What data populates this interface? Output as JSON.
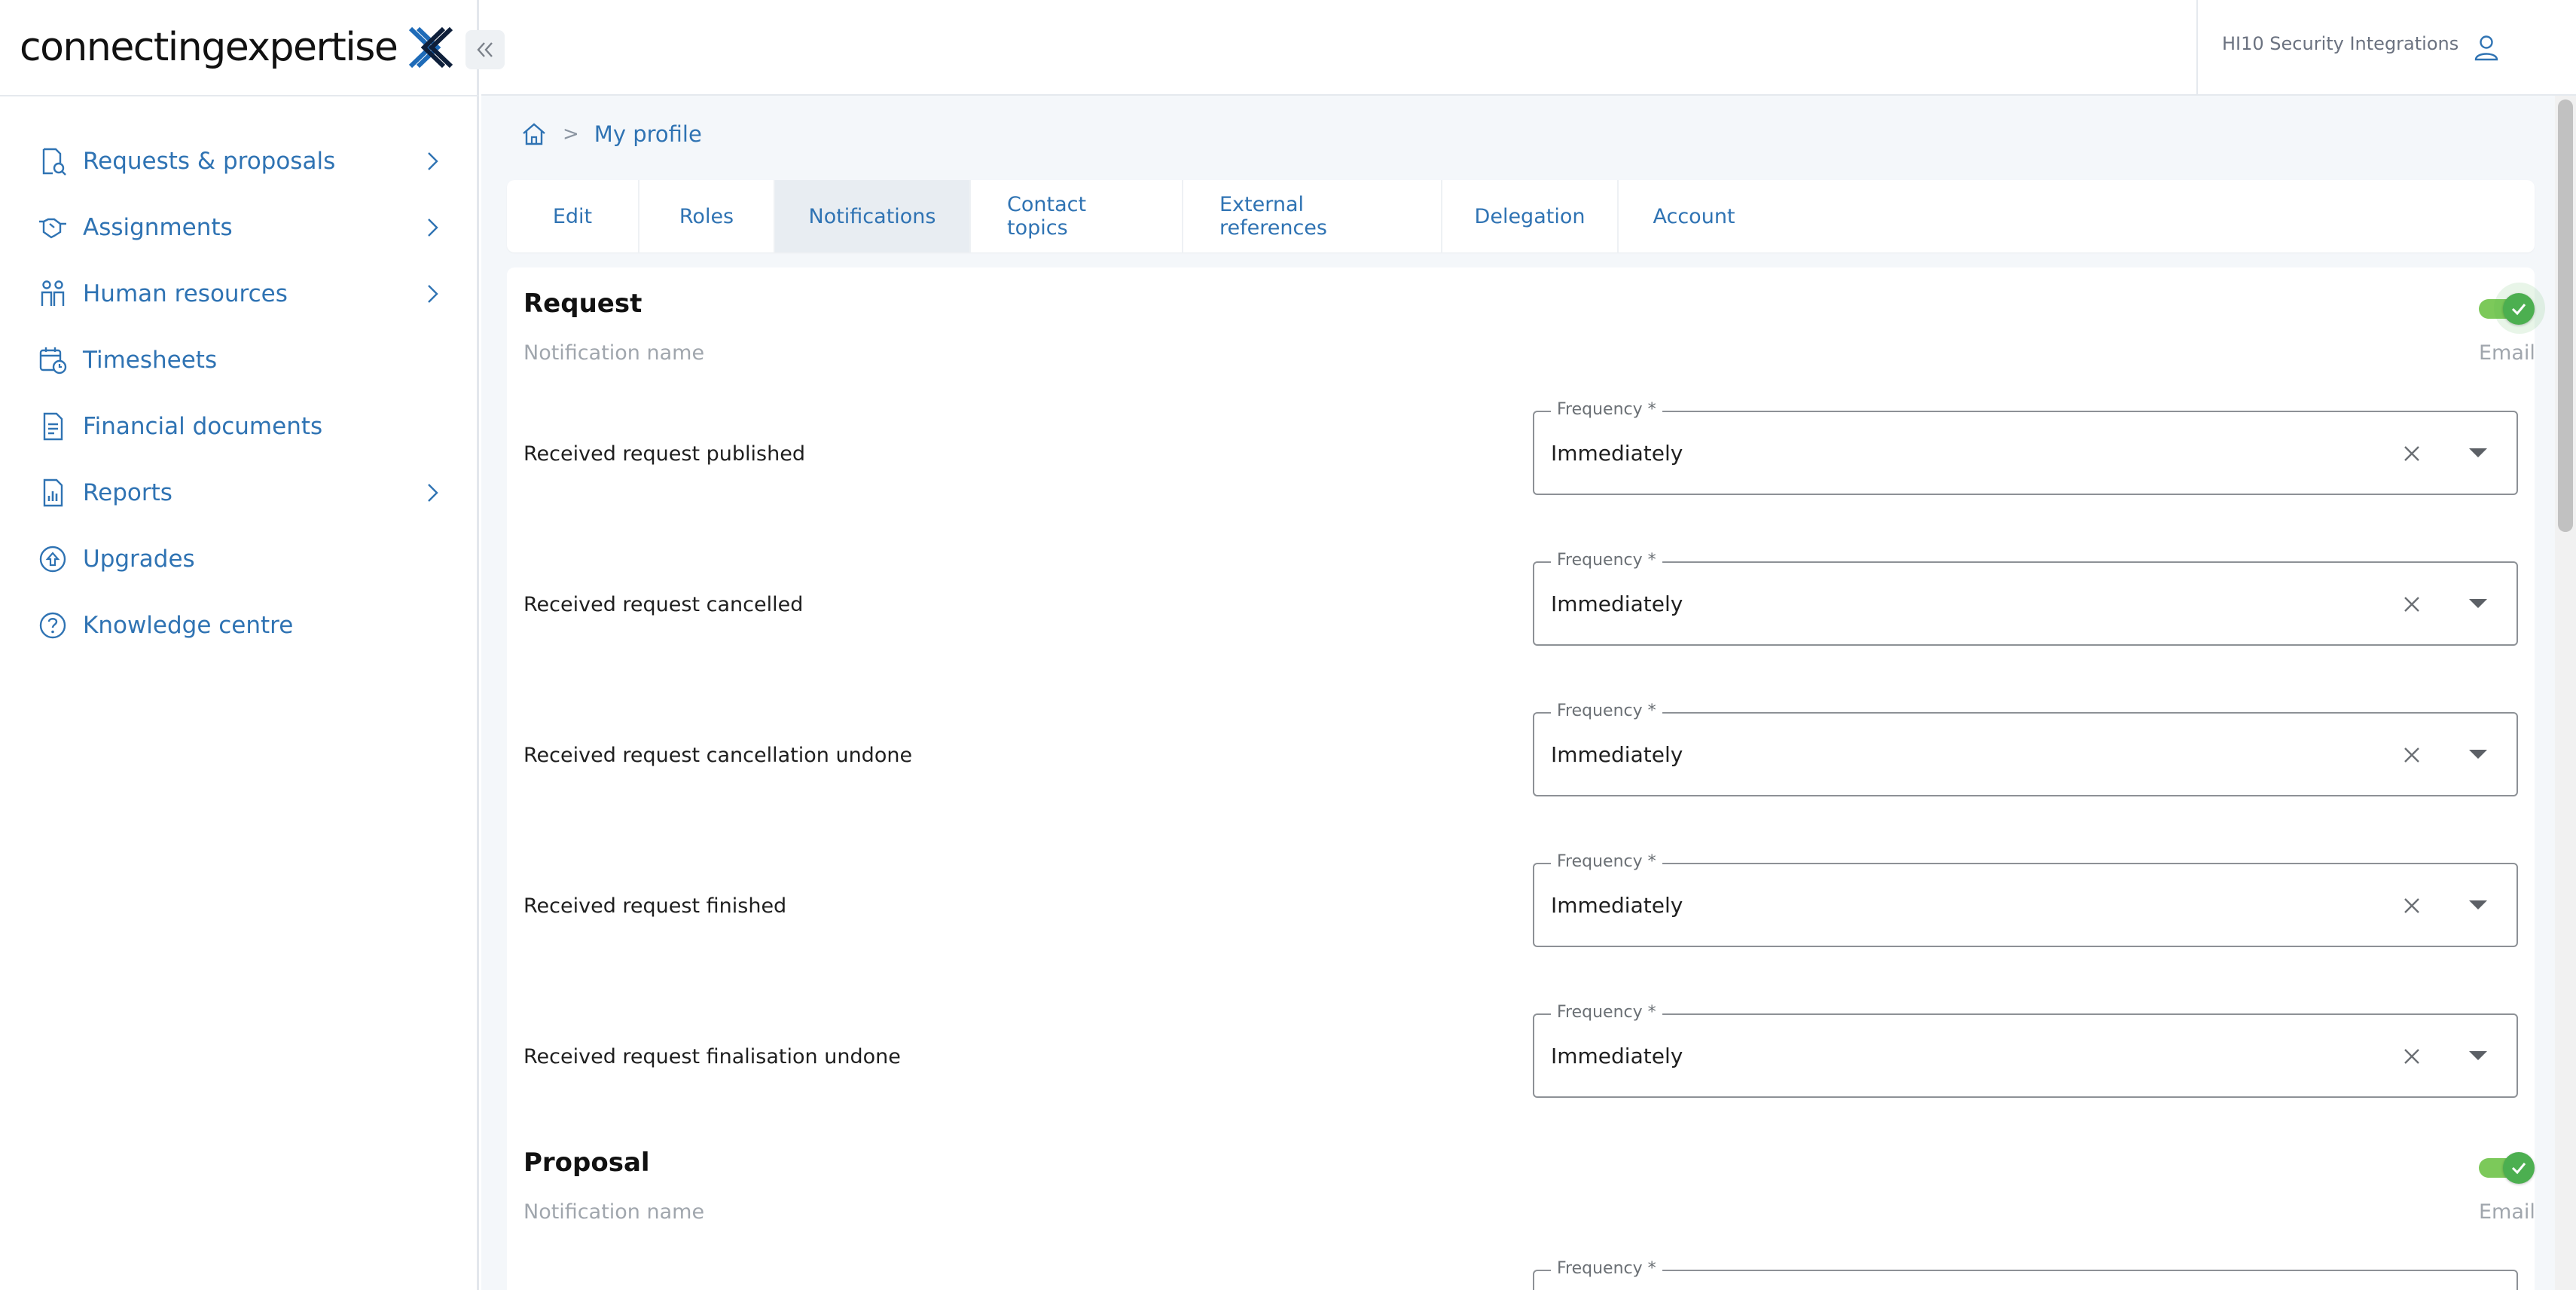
{
  "app": {
    "logo_text": "connectingexpertise",
    "logo_icon": "cross-x-logo-icon",
    "collapse_icon": "double-chevron-left-icon"
  },
  "colors": {
    "accent": "#2f73b3",
    "toggle_on": "#4caf50",
    "toggle_track": "#7cc95a",
    "main_bg": "#f4f7fa",
    "active_tab_bg": "#e8edf2"
  },
  "sidebar": {
    "items": [
      {
        "label": "Requests & proposals",
        "icon": "document-search-icon",
        "has_children": true
      },
      {
        "label": "Assignments",
        "icon": "handshake-icon",
        "has_children": true
      },
      {
        "label": "Human resources",
        "icon": "people-icon",
        "has_children": true
      },
      {
        "label": "Timesheets",
        "icon": "calendar-clock-icon",
        "has_children": false
      },
      {
        "label": "Financial documents",
        "icon": "invoice-icon",
        "has_children": false
      },
      {
        "label": "Reports",
        "icon": "report-icon",
        "has_children": true
      },
      {
        "label": "Upgrades",
        "icon": "upgrade-icon",
        "has_children": false
      },
      {
        "label": "Knowledge centre",
        "icon": "question-circle-icon",
        "has_children": false
      }
    ]
  },
  "header": {
    "user_name": "HI10 Security Integrations",
    "user_icon": "user-icon"
  },
  "breadcrumb": {
    "home_icon": "home-icon",
    "separator": ">",
    "current": "My profile"
  },
  "tabs": [
    {
      "label": "Edit",
      "active": false
    },
    {
      "label": "Roles",
      "active": false
    },
    {
      "label": "Notifications",
      "active": true
    },
    {
      "label": "Contact topics",
      "active": false
    },
    {
      "label": "External references",
      "active": false
    },
    {
      "label": "Delegation",
      "active": false
    },
    {
      "label": "Account",
      "active": false
    }
  ],
  "sections": [
    {
      "title": "Request",
      "name_header": "Notification name",
      "channel_header": "Email",
      "email_enabled": true,
      "rows": [
        {
          "label": "Received request published",
          "frequency_label": "Frequency *",
          "frequency": "Immediately"
        },
        {
          "label": "Received request cancelled",
          "frequency_label": "Frequency *",
          "frequency": "Immediately"
        },
        {
          "label": "Received request cancellation undone",
          "frequency_label": "Frequency *",
          "frequency": "Immediately"
        },
        {
          "label": "Received request finished",
          "frequency_label": "Frequency *",
          "frequency": "Immediately"
        },
        {
          "label": "Received request finalisation undone",
          "frequency_label": "Frequency *",
          "frequency": "Immediately"
        }
      ]
    },
    {
      "title": "Proposal",
      "name_header": "Notification name",
      "channel_header": "Email",
      "email_enabled": true,
      "rows": [
        {
          "label": "",
          "frequency_label": "Frequency *",
          "frequency": ""
        }
      ]
    }
  ]
}
